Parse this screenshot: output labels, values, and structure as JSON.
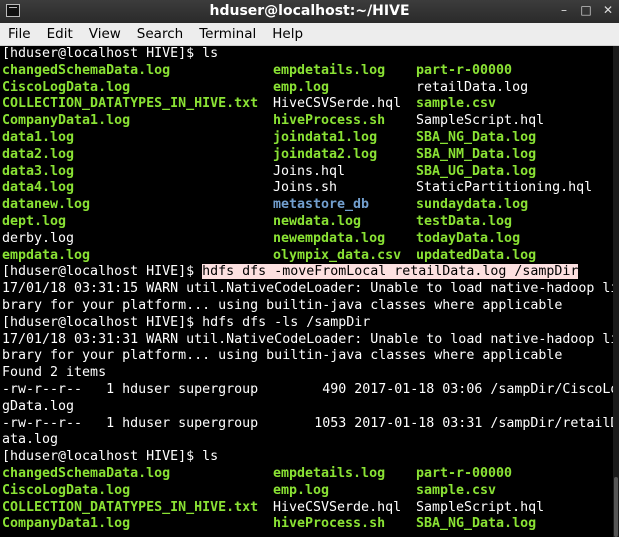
{
  "window": {
    "title": "hduser@localhost:~/HIVE"
  },
  "menu": [
    "File",
    "Edit",
    "View",
    "Search",
    "Terminal",
    "Help"
  ],
  "lines": [
    {
      "type": "text",
      "segments": [
        {
          "t": "[hduser@localhost HIVE]$ ls",
          "c": "plain"
        }
      ]
    },
    {
      "type": "cols",
      "cells": [
        {
          "t": "changedSchemaData.log",
          "c": "green"
        },
        {
          "t": "empdetails.log",
          "c": "green"
        },
        {
          "t": "part-r-00000",
          "c": "green"
        }
      ]
    },
    {
      "type": "cols",
      "cells": [
        {
          "t": "CiscoLogData.log",
          "c": "green"
        },
        {
          "t": "emp.log",
          "c": "green"
        },
        {
          "t": "retailData.log",
          "c": "plain"
        }
      ]
    },
    {
      "type": "cols",
      "cells": [
        {
          "t": "COLLECTION_DATATYPES_IN_HIVE.txt",
          "c": "green"
        },
        {
          "t": "HiveCSVSerde.hql",
          "c": "plain"
        },
        {
          "t": "sample.csv",
          "c": "green"
        }
      ]
    },
    {
      "type": "cols",
      "cells": [
        {
          "t": "CompanyData1.log",
          "c": "green"
        },
        {
          "t": "hiveProcess.sh",
          "c": "green"
        },
        {
          "t": "SampleScript.hql",
          "c": "plain"
        }
      ]
    },
    {
      "type": "cols",
      "cells": [
        {
          "t": "data1.log",
          "c": "green"
        },
        {
          "t": "joindata1.log",
          "c": "green"
        },
        {
          "t": "SBA_NG_Data.log",
          "c": "green"
        }
      ]
    },
    {
      "type": "cols",
      "cells": [
        {
          "t": "data2.log",
          "c": "green"
        },
        {
          "t": "joindata2.log",
          "c": "green"
        },
        {
          "t": "SBA_NM_Data.log",
          "c": "green"
        }
      ]
    },
    {
      "type": "cols",
      "cells": [
        {
          "t": "data3.log",
          "c": "green"
        },
        {
          "t": "Joins.hql",
          "c": "plain"
        },
        {
          "t": "SBA_UG_Data.log",
          "c": "green"
        }
      ]
    },
    {
      "type": "cols",
      "cells": [
        {
          "t": "data4.log",
          "c": "green"
        },
        {
          "t": "Joins.sh",
          "c": "plain"
        },
        {
          "t": "StaticPartitioning.hql",
          "c": "plain"
        }
      ]
    },
    {
      "type": "cols",
      "cells": [
        {
          "t": "datanew.log",
          "c": "green"
        },
        {
          "t": "metastore_db",
          "c": "blue"
        },
        {
          "t": "sundaydata.log",
          "c": "green"
        }
      ]
    },
    {
      "type": "cols",
      "cells": [
        {
          "t": "dept.log",
          "c": "green"
        },
        {
          "t": "newdata.log",
          "c": "green"
        },
        {
          "t": "testData.log",
          "c": "green"
        }
      ]
    },
    {
      "type": "cols",
      "cells": [
        {
          "t": "derby.log",
          "c": "plain"
        },
        {
          "t": "newempdata.log",
          "c": "green"
        },
        {
          "t": "todayData.log",
          "c": "green"
        }
      ]
    },
    {
      "type": "cols",
      "cells": [
        {
          "t": "empdata.log",
          "c": "green"
        },
        {
          "t": "olympix_data.csv",
          "c": "green"
        },
        {
          "t": "updatedData.log",
          "c": "green"
        }
      ]
    },
    {
      "type": "text",
      "segments": [
        {
          "t": "[hduser@localhost HIVE]$ ",
          "c": "plain"
        },
        {
          "t": "hdfs dfs -moveFromLocal retailData.log /sampDir",
          "c": "sel"
        }
      ]
    },
    {
      "type": "text",
      "segments": [
        {
          "t": "17/01/18 03:31:15 WARN util.NativeCodeLoader: Unable to load native-hadoop li",
          "c": "plain"
        }
      ]
    },
    {
      "type": "text",
      "segments": [
        {
          "t": "brary for your platform... using builtin-java classes where applicable",
          "c": "plain"
        }
      ]
    },
    {
      "type": "text",
      "segments": [
        {
          "t": "[hduser@localhost HIVE]$ hdfs dfs -ls /sampDir",
          "c": "plain"
        }
      ]
    },
    {
      "type": "text",
      "segments": [
        {
          "t": "17/01/18 03:31:31 WARN util.NativeCodeLoader: Unable to load native-hadoop li",
          "c": "plain"
        }
      ]
    },
    {
      "type": "text",
      "segments": [
        {
          "t": "brary for your platform... using builtin-java classes where applicable",
          "c": "plain"
        }
      ]
    },
    {
      "type": "text",
      "segments": [
        {
          "t": "Found 2 items",
          "c": "plain"
        }
      ]
    },
    {
      "type": "text",
      "segments": [
        {
          "t": "-rw-r--r--   1 hduser supergroup        490 2017-01-18 03:06 /sampDir/CiscoLo",
          "c": "plain"
        }
      ]
    },
    {
      "type": "text",
      "segments": [
        {
          "t": "gData.log",
          "c": "plain"
        }
      ]
    },
    {
      "type": "text",
      "segments": [
        {
          "t": "-rw-r--r--   1 hduser supergroup       1053 2017-01-18 03:31 /sampDir/retailD",
          "c": "plain"
        }
      ]
    },
    {
      "type": "text",
      "segments": [
        {
          "t": "ata.log",
          "c": "plain"
        }
      ]
    },
    {
      "type": "text",
      "segments": [
        {
          "t": "[hduser@localhost HIVE]$ ls",
          "c": "plain"
        }
      ]
    },
    {
      "type": "cols",
      "cells": [
        {
          "t": "changedSchemaData.log",
          "c": "green"
        },
        {
          "t": "empdetails.log",
          "c": "green"
        },
        {
          "t": "part-r-00000",
          "c": "green"
        }
      ]
    },
    {
      "type": "cols",
      "cells": [
        {
          "t": "CiscoLogData.log",
          "c": "green"
        },
        {
          "t": "emp.log",
          "c": "green"
        },
        {
          "t": "sample.csv",
          "c": "green"
        }
      ]
    },
    {
      "type": "cols",
      "cells": [
        {
          "t": "COLLECTION_DATATYPES_IN_HIVE.txt",
          "c": "green"
        },
        {
          "t": "HiveCSVSerde.hql",
          "c": "plain"
        },
        {
          "t": "SampleScript.hql",
          "c": "plain"
        }
      ]
    },
    {
      "type": "cols",
      "cells": [
        {
          "t": "CompanyData1.log",
          "c": "green"
        },
        {
          "t": "hiveProcess.sh",
          "c": "green"
        },
        {
          "t": "SBA_NG_Data.log",
          "c": "green"
        }
      ]
    }
  ],
  "colors": {
    "green": "#8ae234",
    "blue": "#729fcf",
    "selection": "#fce0e0"
  }
}
